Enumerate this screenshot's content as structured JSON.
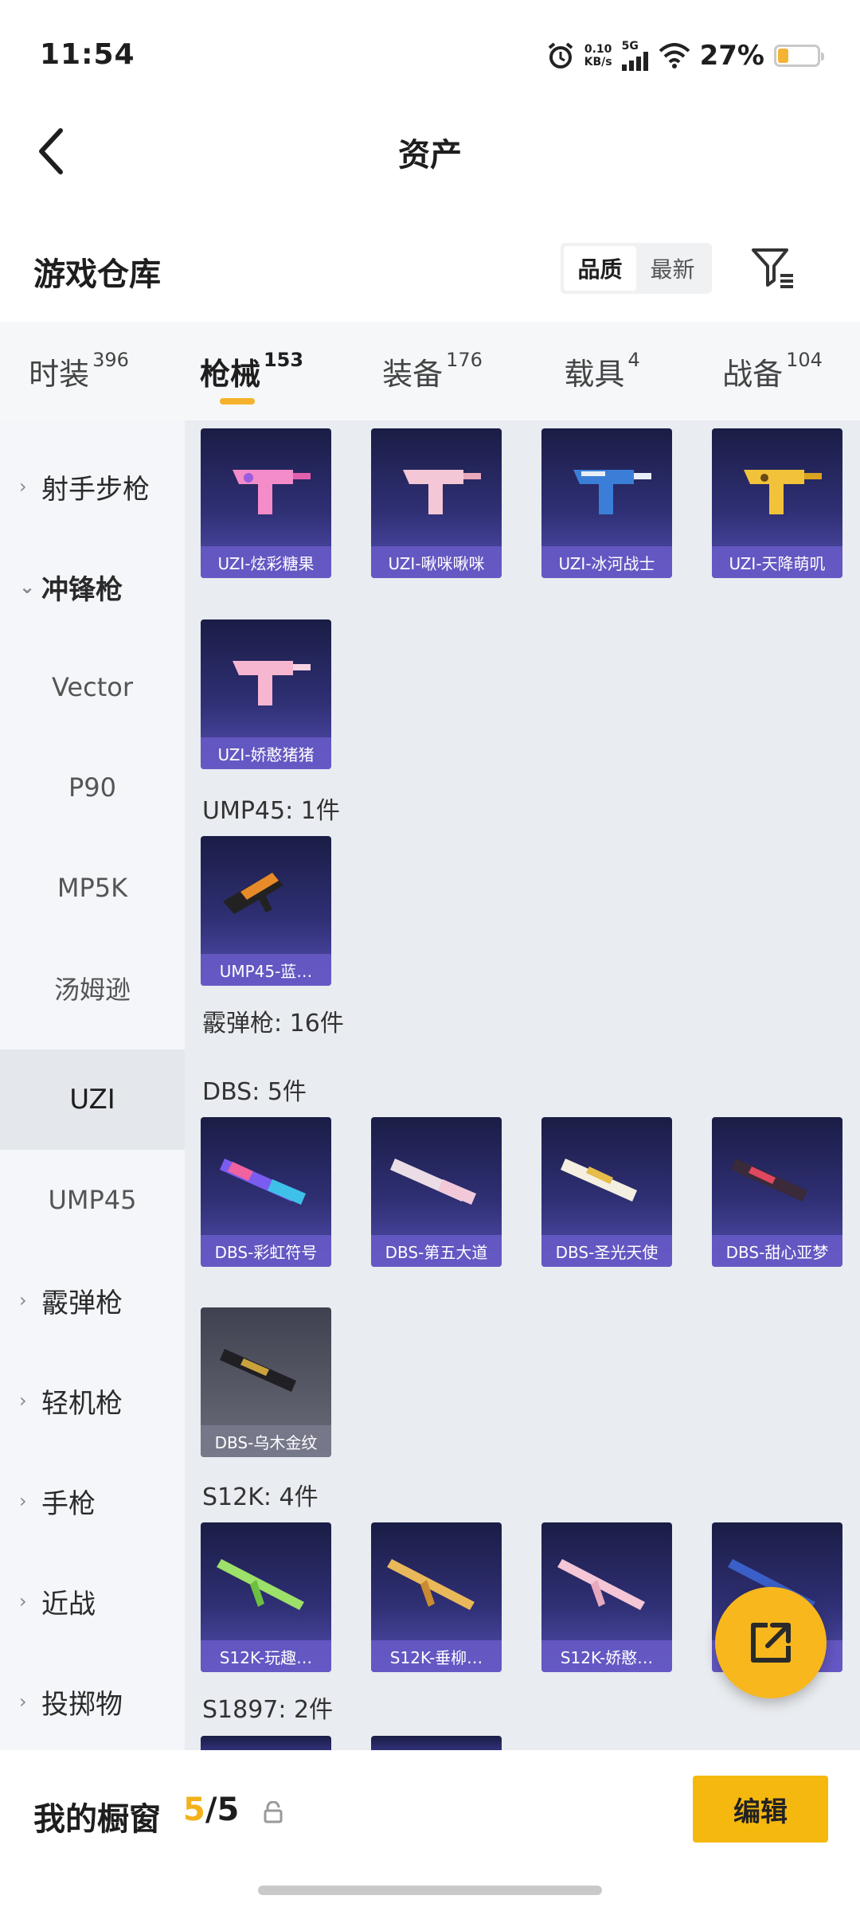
{
  "status_bar": {
    "time": "11:54",
    "speed_value": "0.10",
    "speed_unit": "KB/s",
    "network": "5G",
    "battery": "27%",
    "battery_level": 0.27
  },
  "header": {
    "title": "资产"
  },
  "warehouse": {
    "title": "游戏仓库",
    "sort_options": [
      "品质",
      "最新"
    ],
    "active_sort": "品质"
  },
  "tabs": [
    {
      "label": "时装",
      "count": "396"
    },
    {
      "label": "枪械",
      "count": "153",
      "active": true
    },
    {
      "label": "装备",
      "count": "176"
    },
    {
      "label": "载具",
      "count": "4"
    },
    {
      "label": "战备",
      "count": "104"
    }
  ],
  "sidebar": {
    "items": [
      {
        "label": "射手步枪",
        "type": "category",
        "chevron": "›"
      },
      {
        "label": "冲锋枪",
        "type": "category",
        "chevron": "⌄",
        "open": true
      },
      {
        "label": "Vector",
        "type": "sub"
      },
      {
        "label": "P90",
        "type": "sub"
      },
      {
        "label": "MP5K",
        "type": "sub"
      },
      {
        "label": "汤姆逊",
        "type": "sub"
      },
      {
        "label": "UZI",
        "type": "sub",
        "selected": true
      },
      {
        "label": "UMP45",
        "type": "sub"
      },
      {
        "label": "霰弹枪",
        "type": "category",
        "chevron": "›"
      },
      {
        "label": "轻机枪",
        "type": "category",
        "chevron": "›"
      },
      {
        "label": "手枪",
        "type": "category",
        "chevron": "›"
      },
      {
        "label": "近战",
        "type": "category",
        "chevron": "›"
      },
      {
        "label": "投掷物",
        "type": "category",
        "chevron": "›"
      }
    ]
  },
  "main": {
    "uzi_items": [
      "UZI-炫彩糖果",
      "UZI-啾咪啾咪",
      "UZI-冰河战士",
      "UZI-天降萌叽",
      "UZI-娇憨猪猪"
    ],
    "ump_header": "UMP45: 1件",
    "ump_items": [
      "UMP45-蓝…"
    ],
    "shotgun_header": "霰弹枪: 16件",
    "dbs_header": "DBS: 5件",
    "dbs_items": [
      "DBS-彩虹符号",
      "DBS-第五大道",
      "DBS-圣光天使",
      "DBS-甜心亚梦",
      "DBS-乌木金纹"
    ],
    "s12k_header": "S12K: 4件",
    "s12k_items": [
      "S12K-玩趣…",
      "S12K-垂柳…",
      "S12K-娇憨…",
      ""
    ],
    "s1897_header": "S1897: 2件"
  },
  "bottom": {
    "title": "我的橱窗",
    "current": "5",
    "separator": "/",
    "total": "5",
    "edit_label": "编辑"
  },
  "colors": {
    "accent": "#f5b80f",
    "card_top": "#1a1d45",
    "card_bottom": "#5350b2"
  },
  "icons": {
    "back": "chevron-left-icon",
    "filter": "filter-icon",
    "fab": "share-icon",
    "lock": "lock-icon"
  }
}
